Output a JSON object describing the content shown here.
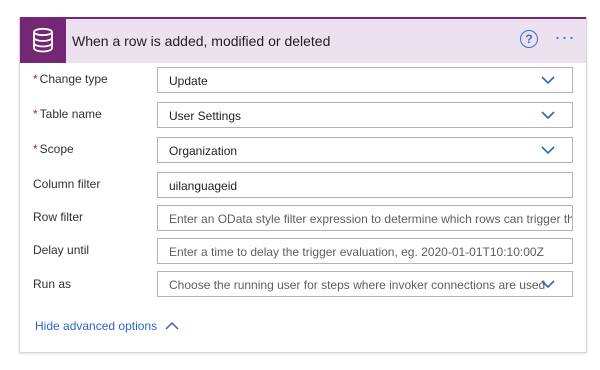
{
  "header": {
    "title": "When a row is added, modified or deleted",
    "app_icon": "database-icon",
    "help_icon": "help-circle-icon",
    "more_icon": "more-horizontal-icon",
    "help_glyph": "?",
    "more_glyph": "···",
    "accent": "#742774",
    "band_color": "#ece1ee",
    "link_color": "#3b6bdc"
  },
  "fields": {
    "change_type": {
      "label": "Change type",
      "required_mark": "*",
      "value": "Update"
    },
    "table_name": {
      "label": "Table name",
      "required_mark": "*",
      "value": "User Settings"
    },
    "scope": {
      "label": "Scope",
      "required_mark": "*",
      "value": "Organization"
    },
    "column_filter": {
      "label": "Column filter",
      "value": "uilanguageid"
    },
    "row_filter": {
      "label": "Row filter",
      "placeholder": "Enter an OData style filter expression to determine which rows can trigger the flow"
    },
    "delay_until": {
      "label": "Delay until",
      "placeholder": "Enter a time to delay the trigger evaluation, eg. 2020-01-01T10:10:00Z"
    },
    "run_as": {
      "label": "Run as",
      "placeholder": "Choose the running user for steps where invoker connections are used"
    }
  },
  "advanced_toggle": {
    "label": "Hide advanced options",
    "icon": "chevron-up-icon"
  }
}
